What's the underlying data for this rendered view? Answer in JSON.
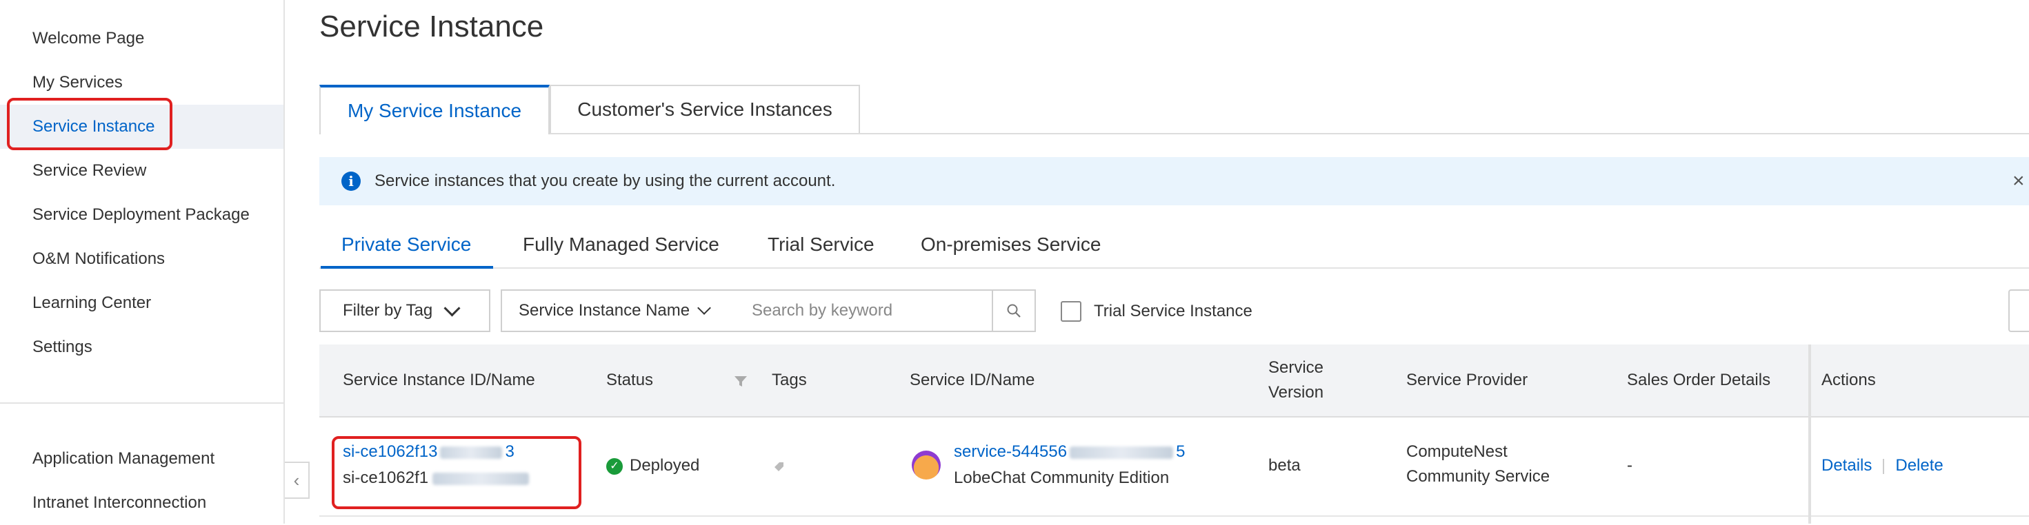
{
  "sidebar": {
    "items": [
      {
        "label": "Welcome Page"
      },
      {
        "label": "My Services"
      },
      {
        "label": "Service Instance"
      },
      {
        "label": "Service Review"
      },
      {
        "label": "Service Deployment Package"
      },
      {
        "label": "O&M Notifications"
      },
      {
        "label": "Learning Center"
      },
      {
        "label": "Settings"
      }
    ],
    "bottom_items": [
      {
        "label": "Application Management"
      },
      {
        "label": "Intranet Interconnection"
      }
    ],
    "active": "Service Instance",
    "collapse_icon": "chevron-left-icon"
  },
  "page": {
    "title": "Service Instance"
  },
  "tabs": [
    {
      "label": "My Service Instance"
    },
    {
      "label": "Customer's Service Instances"
    }
  ],
  "info": {
    "text": "Service instances that you create by using the current account.",
    "close": "×"
  },
  "subtabs": [
    {
      "label": "Private Service"
    },
    {
      "label": "Fully Managed Service"
    },
    {
      "label": "Trial Service"
    },
    {
      "label": "On-premises Service"
    }
  ],
  "filters": {
    "tag_label": "Filter by Tag",
    "field_label": "Service Instance Name",
    "search_placeholder": "Search by keyword",
    "trial_checkbox_label": "Trial Service Instance"
  },
  "table": {
    "headers": {
      "instance": "Service Instance ID/Name",
      "status": "Status",
      "tags": "Tags",
      "service": "Service ID/Name",
      "version_line1": "Service",
      "version_line2": "Version",
      "provider": "Service Provider",
      "sales": "Sales Order Details",
      "actions": "Actions"
    },
    "rows": [
      {
        "instance_id": "si-ce1062f13",
        "instance_id_end": "3",
        "instance_name": "si-ce1062f1",
        "status": "Deployed",
        "service_id": "service-544556",
        "service_id_end": "5",
        "service_name": "LobeChat Community Edition",
        "version": "beta",
        "provider_line1": "ComputeNest",
        "provider_line2": "Community Service",
        "sales": "-",
        "action_details": "Details",
        "action_delete": "Delete"
      }
    ]
  },
  "colors": {
    "accent": "#0064c8",
    "highlight": "#e02020",
    "success": "#1a9b3a",
    "info_bg": "#e9f4fd"
  }
}
